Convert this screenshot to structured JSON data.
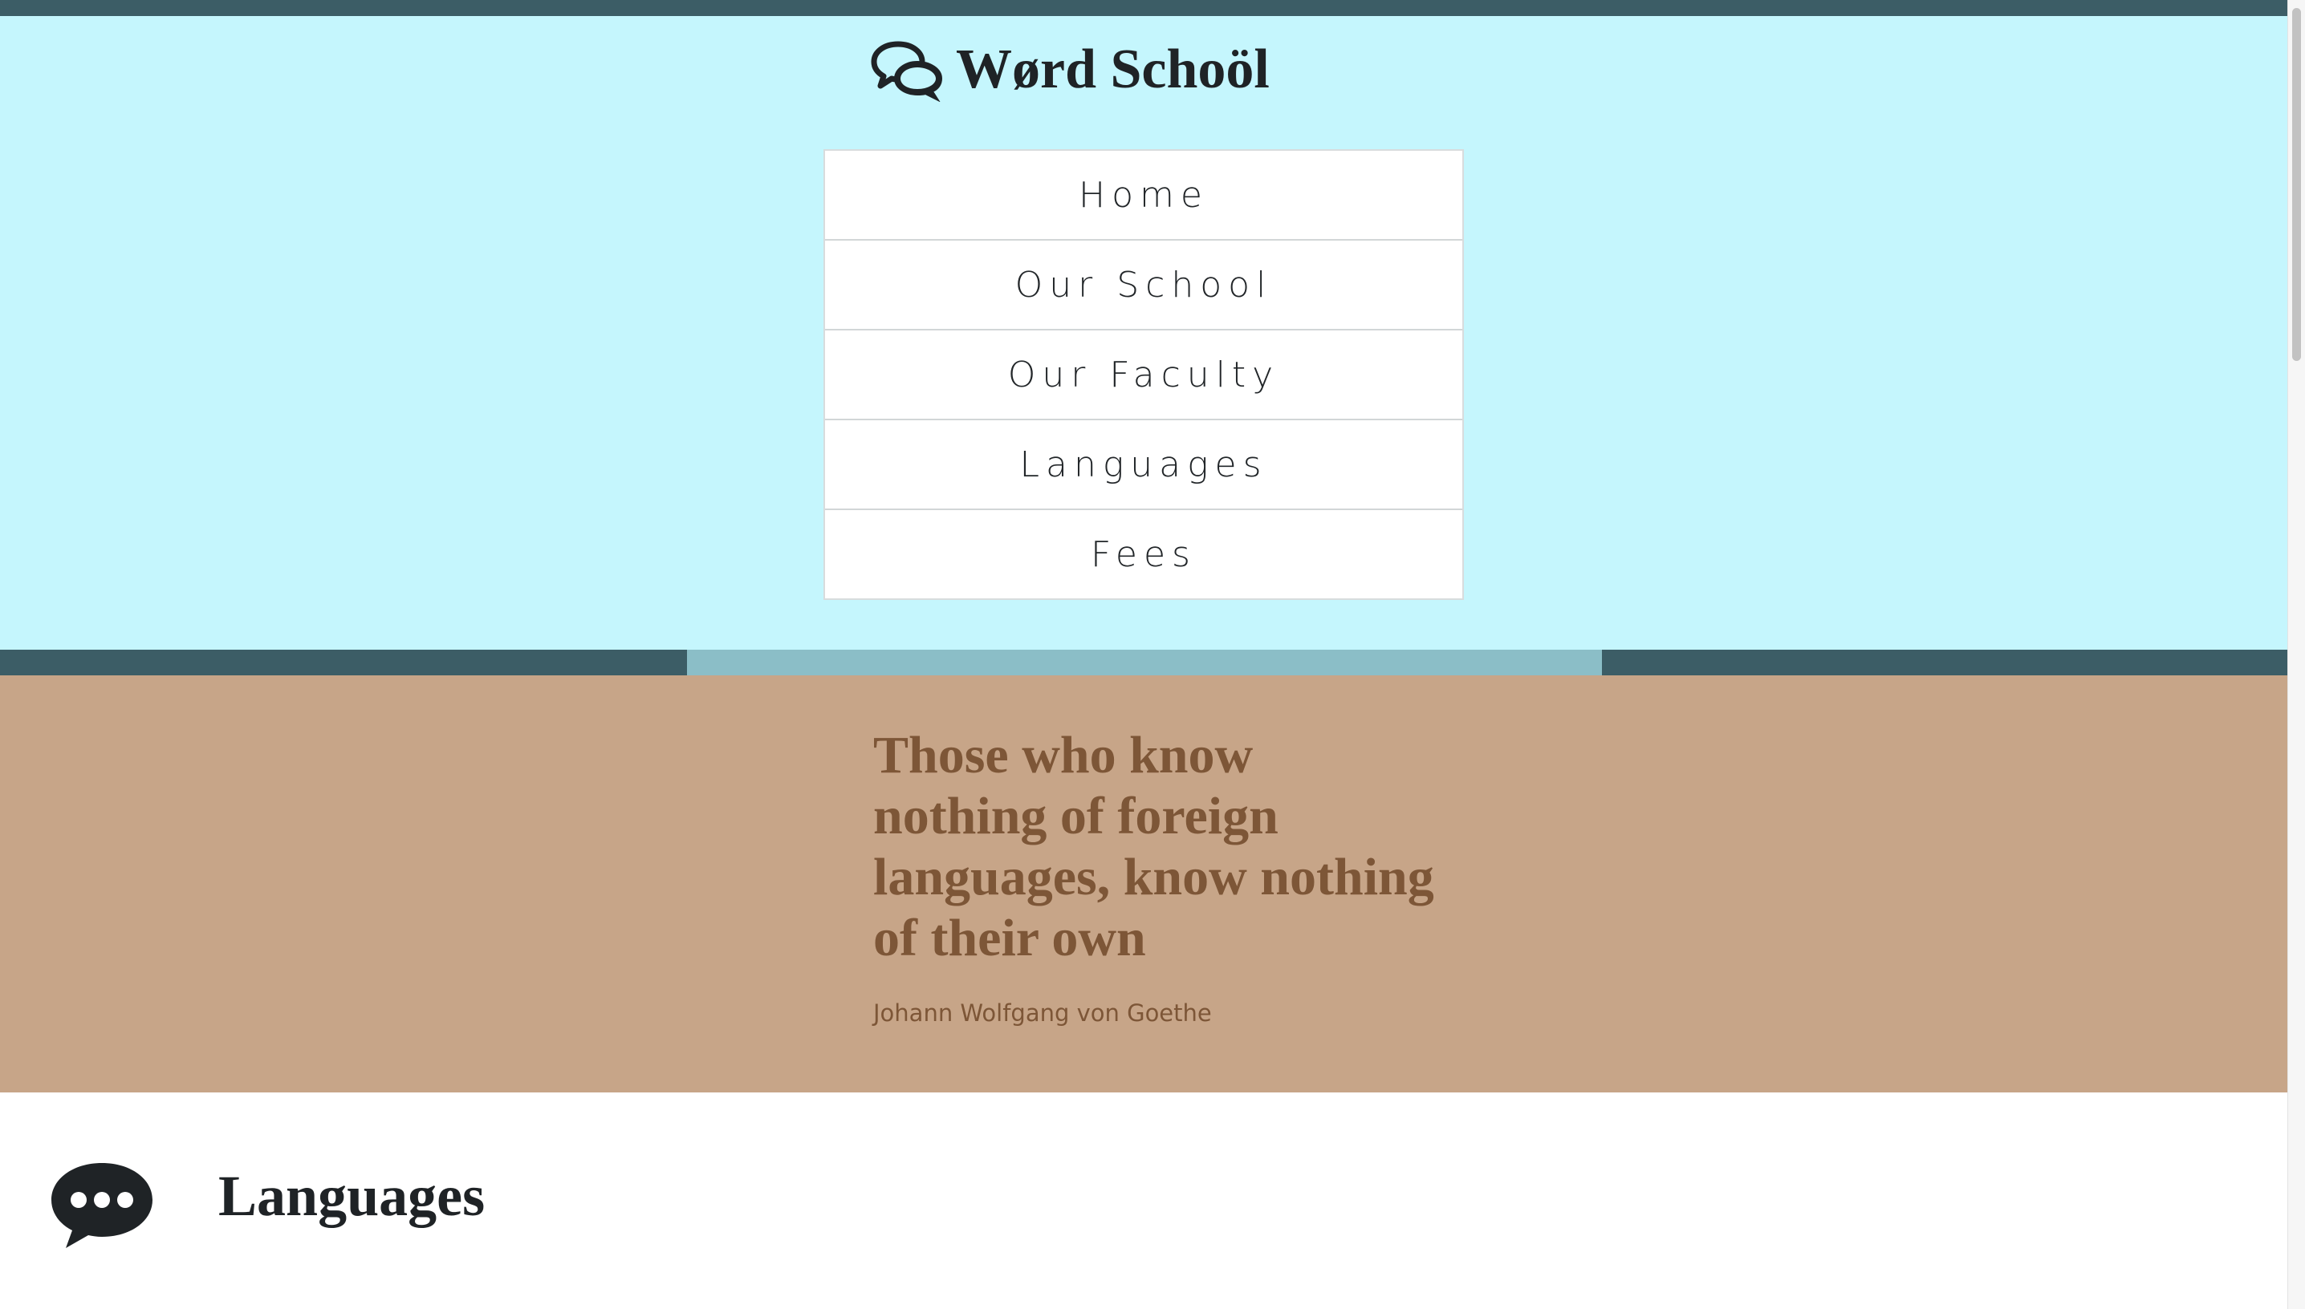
{
  "site": {
    "title": "Wørd Schoöl",
    "logo_icon": "speech-bubbles-icon"
  },
  "nav": {
    "items": [
      {
        "label": "Home"
      },
      {
        "label": "Our School"
      },
      {
        "label": "Our Faculty"
      },
      {
        "label": "Languages"
      },
      {
        "label": "Fees"
      }
    ]
  },
  "quote": {
    "text": "Those who know nothing of foreign languages, know nothing of their own",
    "author": "Johann Wolfgang von Goethe"
  },
  "section": {
    "title": "Languages",
    "icon": "speech-bubble-ellipsis-icon"
  },
  "colors": {
    "header_bg": "#c5f6fd",
    "dark_teal": "#3c5d66",
    "light_teal": "#8bbec7",
    "quote_bg": "#c7a588",
    "quote_text": "#7d5637",
    "text_dark": "#1f2326"
  }
}
